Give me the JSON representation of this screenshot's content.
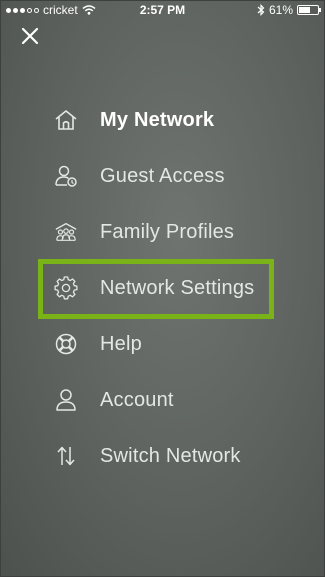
{
  "status_bar": {
    "carrier": "cricket",
    "time": "2:57 PM",
    "battery_percent": "61%",
    "battery_level": 0.61
  },
  "menu": {
    "items": [
      {
        "label": "My Network",
        "icon": "home-icon",
        "active": true
      },
      {
        "label": "Guest Access",
        "icon": "guest-user-icon",
        "active": false
      },
      {
        "label": "Family Profiles",
        "icon": "family-icon",
        "active": false
      },
      {
        "label": "Network Settings",
        "icon": "gear-icon",
        "active": false
      },
      {
        "label": "Help",
        "icon": "lifebuoy-icon",
        "active": false
      },
      {
        "label": "Account",
        "icon": "user-icon",
        "active": false
      },
      {
        "label": "Switch Network",
        "icon": "switch-arrows-icon",
        "active": false
      }
    ]
  },
  "colors": {
    "highlight": "#7ab317",
    "text": "#e4e7e4",
    "background": "#5d625e"
  }
}
